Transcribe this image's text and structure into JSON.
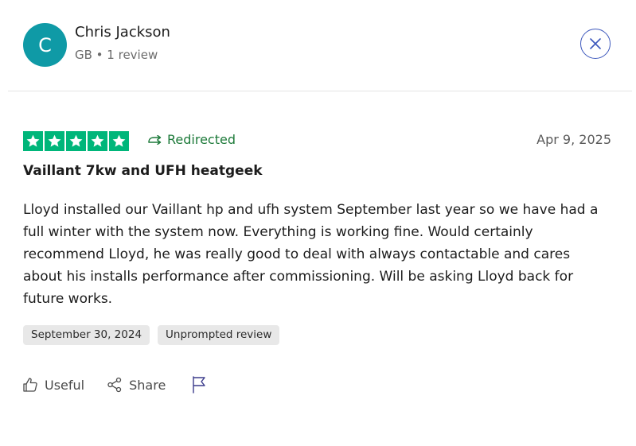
{
  "reviewer": {
    "initial": "C",
    "name": "Chris Jackson",
    "meta": "GB • 1 review"
  },
  "review": {
    "rating": 5,
    "rating_max": 5,
    "redirect_label": "Redirected",
    "date": "Apr 9, 2025",
    "title": "Vaillant 7kw and UFH heatgeek",
    "body": "Lloyd installed our Vaillant hp and ufh system September last year so we have had a full winter with the system now. Everything is working fine. Would certainly recommend Lloyd, he was really good to deal with always contactable and cares about his installs performance after commissioning. Will be asking Lloyd back for future works.",
    "tags": [
      "September 30, 2024",
      "Unprompted review"
    ]
  },
  "actions": {
    "useful_label": "Useful",
    "share_label": "Share"
  },
  "icons": {
    "close": "close-icon",
    "star": "star-icon",
    "redirect": "redirect-arrow-icon",
    "useful": "thumbs-up-icon",
    "share": "share-icon",
    "report": "flag-icon"
  },
  "colors": {
    "avatar_bg": "#0f9aa6",
    "star_green": "#00b67a",
    "redirect_green": "#1d7a3a",
    "close_blue": "#3c57bc",
    "tag_bg": "#e8e8e8"
  }
}
